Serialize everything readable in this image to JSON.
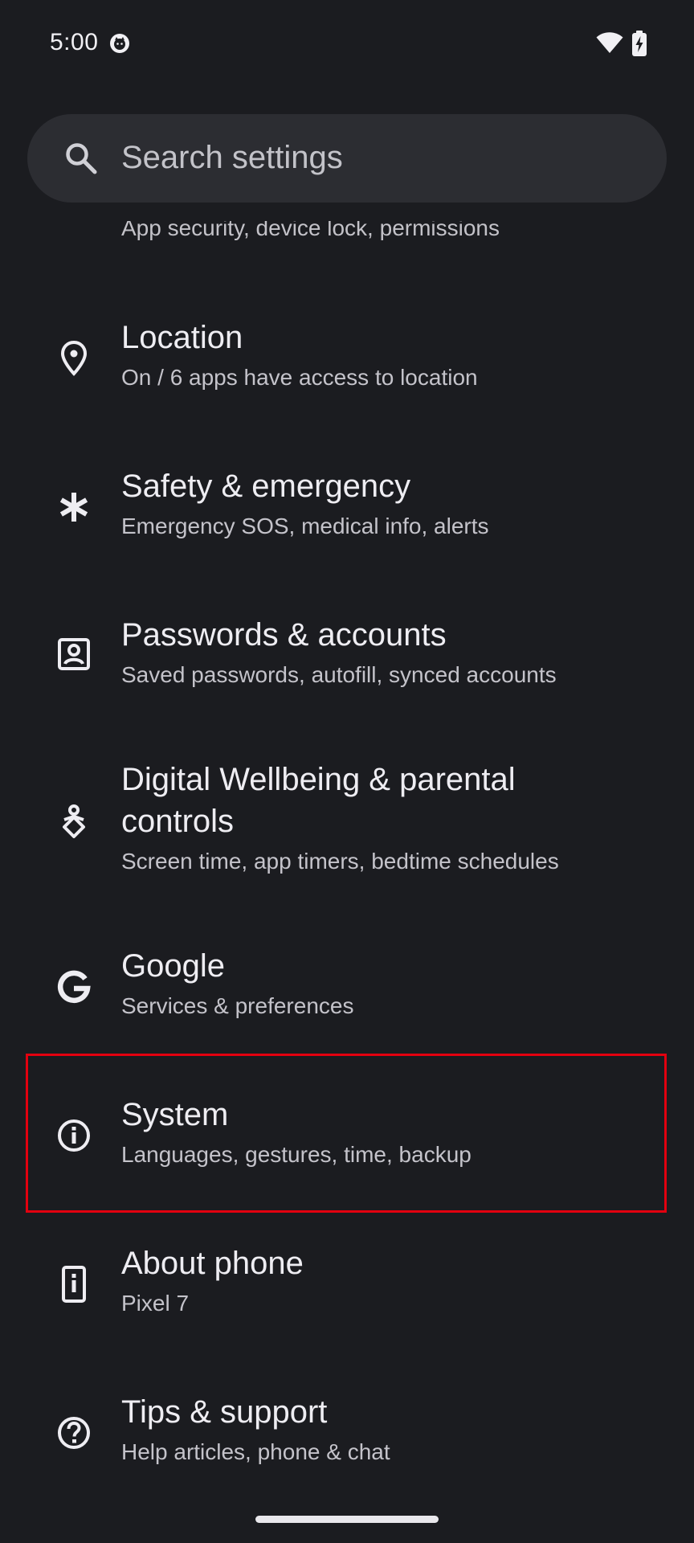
{
  "status_bar": {
    "time": "5:00",
    "icons": [
      "notification-cat-icon",
      "wifi-icon",
      "battery-charging-icon"
    ]
  },
  "search": {
    "placeholder": "Search settings"
  },
  "clipped_item": {
    "subtitle": "App security, device lock, permissions"
  },
  "settings_items": [
    {
      "icon": "location-pin-icon",
      "title": "Location",
      "subtitle": "On / 6 apps have access to location"
    },
    {
      "icon": "asterisk-icon",
      "title": "Safety & emergency",
      "subtitle": "Emergency SOS, medical info, alerts"
    },
    {
      "icon": "account-box-icon",
      "title": "Passwords & accounts",
      "subtitle": "Saved passwords, autofill, synced accounts"
    },
    {
      "icon": "wellbeing-icon",
      "title_line1": "Digital Wellbeing & parental",
      "title_line2": "controls",
      "subtitle": "Screen time, app timers, bedtime schedules"
    },
    {
      "icon": "google-g-icon",
      "title": "Google",
      "subtitle": "Services & preferences"
    },
    {
      "icon": "info-icon",
      "title": "System",
      "subtitle": "Languages, gestures, time, backup",
      "highlighted": true
    },
    {
      "icon": "phone-info-icon",
      "title": "About phone",
      "subtitle": "Pixel 7"
    },
    {
      "icon": "help-circle-icon",
      "title": "Tips & support",
      "subtitle": "Help articles, phone & chat"
    }
  ],
  "colors": {
    "background": "#1b1c20",
    "search_bar": "#2c2d32",
    "highlight": "#e3000f",
    "title_text": "#eeedf2",
    "subtitle_text": "#c4c3ca"
  }
}
